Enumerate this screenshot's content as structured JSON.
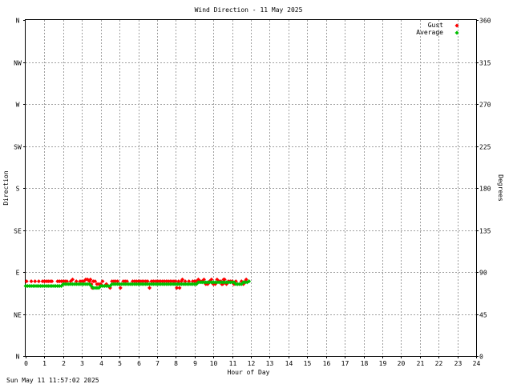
{
  "chart_data": {
    "type": "scatter",
    "title": "Wind Direction - 11 May 2025",
    "xlabel": "Hour of Day",
    "ylabel_left": "Direction",
    "ylabel_right": "Degrees",
    "xlim": [
      0,
      24
    ],
    "ylim": [
      0,
      360
    ],
    "grid": true,
    "legend_position": "top-right",
    "x_ticks": [
      0,
      1,
      2,
      3,
      4,
      5,
      6,
      7,
      8,
      9,
      10,
      11,
      12,
      13,
      14,
      15,
      16,
      17,
      18,
      19,
      20,
      21,
      22,
      23,
      24
    ],
    "x_tick_labels": [
      "0",
      "1",
      "2",
      "3",
      "4",
      "5",
      "6",
      "7",
      "8",
      "9",
      "10",
      "11",
      "12",
      "13",
      "14",
      "15",
      "16",
      "17",
      "18",
      "19",
      "20",
      "21",
      "22",
      "23",
      "24"
    ],
    "y_left_ticks": [
      0,
      45,
      90,
      135,
      180,
      225,
      270,
      315,
      360
    ],
    "y_left_labels": [
      "N",
      "NE",
      "E",
      "SE",
      "S",
      "SW",
      "W",
      "NW",
      "N"
    ],
    "y_right_ticks": [
      0,
      45,
      90,
      135,
      180,
      225,
      270,
      315,
      360
    ],
    "y_right_labels": [
      "0",
      "45",
      "90",
      "135",
      "180",
      "225",
      "270",
      "315",
      "360"
    ],
    "series": [
      {
        "name": "Gust",
        "color": "#ff0000",
        "marker": "diamond",
        "points": [
          [
            0.05,
            80
          ],
          [
            0.3,
            80
          ],
          [
            0.5,
            80
          ],
          [
            0.7,
            80
          ],
          [
            0.9,
            80
          ],
          [
            1.0,
            80
          ],
          [
            1.1,
            80
          ],
          [
            1.2,
            80
          ],
          [
            1.3,
            80
          ],
          [
            1.4,
            80
          ],
          [
            1.7,
            80
          ],
          [
            1.8,
            80
          ],
          [
            1.9,
            80
          ],
          [
            2.0,
            80
          ],
          [
            2.1,
            80
          ],
          [
            2.2,
            80
          ],
          [
            2.4,
            80
          ],
          [
            2.5,
            82
          ],
          [
            2.7,
            80
          ],
          [
            2.9,
            80
          ],
          [
            3.0,
            80
          ],
          [
            3.1,
            80
          ],
          [
            3.2,
            82
          ],
          [
            3.3,
            82
          ],
          [
            3.4,
            80
          ],
          [
            3.45,
            82
          ],
          [
            3.5,
            77
          ],
          [
            3.55,
            73
          ],
          [
            3.6,
            80
          ],
          [
            3.7,
            80
          ],
          [
            3.8,
            77
          ],
          [
            3.9,
            77
          ],
          [
            4.0,
            77
          ],
          [
            4.1,
            80
          ],
          [
            4.3,
            77
          ],
          [
            4.5,
            73
          ],
          [
            4.6,
            80
          ],
          [
            4.7,
            80
          ],
          [
            4.8,
            80
          ],
          [
            4.9,
            80
          ],
          [
            5.0,
            77
          ],
          [
            5.05,
            73
          ],
          [
            5.2,
            80
          ],
          [
            5.3,
            80
          ],
          [
            5.4,
            80
          ],
          [
            5.6,
            77
          ],
          [
            5.7,
            80
          ],
          [
            5.8,
            80
          ],
          [
            5.9,
            80
          ],
          [
            6.0,
            80
          ],
          [
            6.1,
            80
          ],
          [
            6.2,
            80
          ],
          [
            6.3,
            80
          ],
          [
            6.4,
            80
          ],
          [
            6.5,
            80
          ],
          [
            6.6,
            73
          ],
          [
            6.7,
            80
          ],
          [
            6.8,
            80
          ],
          [
            6.9,
            80
          ],
          [
            7.0,
            80
          ],
          [
            7.1,
            80
          ],
          [
            7.2,
            80
          ],
          [
            7.3,
            80
          ],
          [
            7.4,
            80
          ],
          [
            7.5,
            80
          ],
          [
            7.6,
            80
          ],
          [
            7.7,
            80
          ],
          [
            7.8,
            80
          ],
          [
            7.9,
            80
          ],
          [
            8.0,
            80
          ],
          [
            8.05,
            73
          ],
          [
            8.1,
            77
          ],
          [
            8.15,
            80
          ],
          [
            8.2,
            73
          ],
          [
            8.3,
            80
          ],
          [
            8.35,
            82
          ],
          [
            8.5,
            80
          ],
          [
            8.7,
            80
          ],
          [
            8.9,
            80
          ],
          [
            9.0,
            80
          ],
          [
            9.1,
            80
          ],
          [
            9.2,
            82
          ],
          [
            9.3,
            80
          ],
          [
            9.4,
            80
          ],
          [
            9.5,
            82
          ],
          [
            9.6,
            77
          ],
          [
            9.7,
            77
          ],
          [
            9.8,
            80
          ],
          [
            9.9,
            82
          ],
          [
            10.0,
            77
          ],
          [
            10.1,
            77
          ],
          [
            10.2,
            82
          ],
          [
            10.3,
            80
          ],
          [
            10.4,
            80
          ],
          [
            10.45,
            77
          ],
          [
            10.5,
            77
          ],
          [
            10.55,
            82
          ],
          [
            10.6,
            82
          ],
          [
            10.7,
            77
          ],
          [
            10.8,
            80
          ],
          [
            10.9,
            80
          ],
          [
            11.0,
            80
          ],
          [
            11.1,
            77
          ],
          [
            11.2,
            80
          ],
          [
            11.3,
            77
          ],
          [
            11.4,
            77
          ],
          [
            11.5,
            80
          ],
          [
            11.6,
            77
          ],
          [
            11.7,
            80
          ],
          [
            11.75,
            82
          ]
        ]
      },
      {
        "name": "Average",
        "color": "#00c000",
        "marker": "diamond",
        "points": [
          [
            0.0,
            75
          ],
          [
            0.1,
            75
          ],
          [
            0.2,
            75
          ],
          [
            0.3,
            75
          ],
          [
            0.4,
            75
          ],
          [
            0.5,
            75
          ],
          [
            0.6,
            75
          ],
          [
            0.7,
            75
          ],
          [
            0.8,
            75
          ],
          [
            0.9,
            75
          ],
          [
            1.0,
            75
          ],
          [
            1.1,
            75
          ],
          [
            1.2,
            75
          ],
          [
            1.3,
            75
          ],
          [
            1.4,
            75
          ],
          [
            1.5,
            75
          ],
          [
            1.6,
            75
          ],
          [
            1.7,
            75
          ],
          [
            1.8,
            75
          ],
          [
            1.9,
            75
          ],
          [
            2.0,
            77
          ],
          [
            2.1,
            77
          ],
          [
            2.2,
            77
          ],
          [
            2.3,
            77
          ],
          [
            2.4,
            77
          ],
          [
            2.5,
            77
          ],
          [
            2.6,
            77
          ],
          [
            2.7,
            77
          ],
          [
            2.8,
            77
          ],
          [
            2.9,
            77
          ],
          [
            3.0,
            77
          ],
          [
            3.1,
            77
          ],
          [
            3.2,
            77
          ],
          [
            3.3,
            77
          ],
          [
            3.4,
            77
          ],
          [
            3.5,
            75
          ],
          [
            3.6,
            73
          ],
          [
            3.7,
            73
          ],
          [
            3.8,
            73
          ],
          [
            3.9,
            73
          ],
          [
            4.0,
            75
          ],
          [
            4.1,
            75
          ],
          [
            4.2,
            75
          ],
          [
            4.3,
            75
          ],
          [
            4.4,
            75
          ],
          [
            4.5,
            75
          ],
          [
            4.6,
            77
          ],
          [
            4.7,
            77
          ],
          [
            4.8,
            77
          ],
          [
            4.9,
            77
          ],
          [
            5.0,
            77
          ],
          [
            5.1,
            77
          ],
          [
            5.2,
            77
          ],
          [
            5.3,
            77
          ],
          [
            5.4,
            77
          ],
          [
            5.5,
            77
          ],
          [
            5.6,
            77
          ],
          [
            5.7,
            77
          ],
          [
            5.8,
            77
          ],
          [
            5.9,
            77
          ],
          [
            6.0,
            77
          ],
          [
            6.1,
            77
          ],
          [
            6.2,
            77
          ],
          [
            6.3,
            77
          ],
          [
            6.4,
            77
          ],
          [
            6.5,
            77
          ],
          [
            6.6,
            77
          ],
          [
            6.7,
            77
          ],
          [
            6.8,
            77
          ],
          [
            6.9,
            77
          ],
          [
            7.0,
            77
          ],
          [
            7.1,
            77
          ],
          [
            7.2,
            77
          ],
          [
            7.3,
            77
          ],
          [
            7.4,
            77
          ],
          [
            7.5,
            77
          ],
          [
            7.6,
            77
          ],
          [
            7.7,
            77
          ],
          [
            7.8,
            77
          ],
          [
            7.9,
            77
          ],
          [
            8.0,
            77
          ],
          [
            8.1,
            77
          ],
          [
            8.2,
            77
          ],
          [
            8.3,
            77
          ],
          [
            8.4,
            77
          ],
          [
            8.5,
            77
          ],
          [
            8.6,
            77
          ],
          [
            8.7,
            77
          ],
          [
            8.8,
            77
          ],
          [
            8.9,
            77
          ],
          [
            9.0,
            77
          ],
          [
            9.1,
            77
          ],
          [
            9.2,
            79
          ],
          [
            9.3,
            79
          ],
          [
            9.4,
            79
          ],
          [
            9.5,
            79
          ],
          [
            9.6,
            79
          ],
          [
            9.7,
            79
          ],
          [
            9.8,
            79
          ],
          [
            9.9,
            79
          ],
          [
            10.0,
            79
          ],
          [
            10.1,
            79
          ],
          [
            10.2,
            79
          ],
          [
            10.3,
            79
          ],
          [
            10.4,
            79
          ],
          [
            10.5,
            79
          ],
          [
            10.6,
            79
          ],
          [
            10.7,
            79
          ],
          [
            10.8,
            79
          ],
          [
            10.9,
            79
          ],
          [
            11.0,
            79
          ],
          [
            11.1,
            79
          ],
          [
            11.2,
            77
          ],
          [
            11.3,
            77
          ],
          [
            11.4,
            77
          ],
          [
            11.5,
            77
          ],
          [
            11.6,
            79
          ],
          [
            11.7,
            79
          ],
          [
            11.8,
            79
          ],
          [
            11.9,
            80
          ]
        ]
      }
    ]
  },
  "footer": {
    "timestamp": "Sun May 11 11:57:02 2025"
  }
}
